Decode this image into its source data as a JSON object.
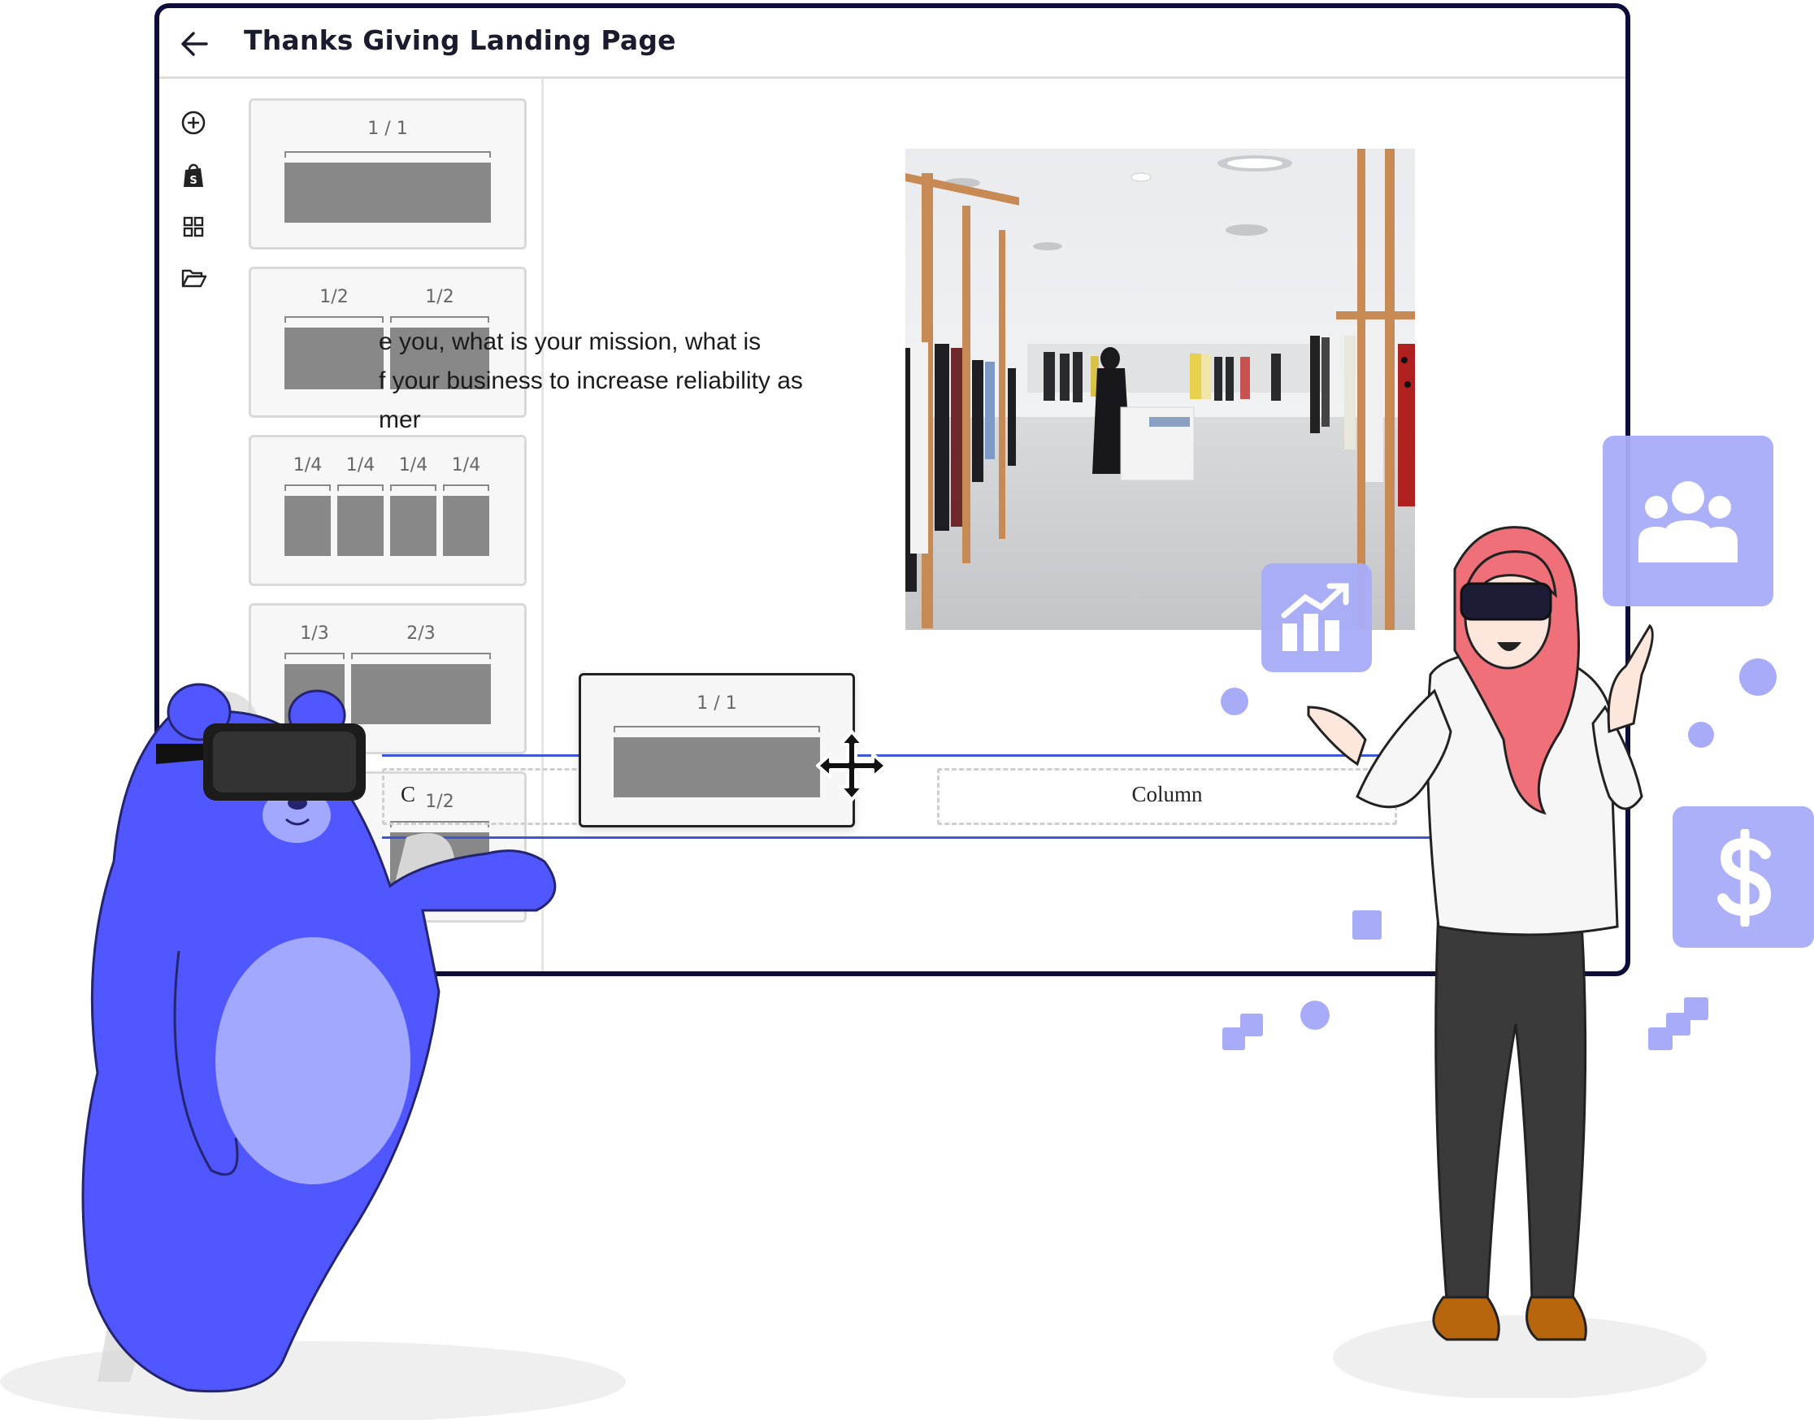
{
  "editor": {
    "title": "Thanks Giving Landing Page",
    "sidebar_icons": [
      "add-circle-icon",
      "shopify-bag-icon",
      "grid-icon",
      "folder-open-icon"
    ],
    "layouts": [
      {
        "labels": [
          "1 / 1"
        ]
      },
      {
        "labels": [
          "1/2",
          "1/2"
        ]
      },
      {
        "labels": [
          "1/4",
          "1/4",
          "1/4",
          "1/4"
        ]
      },
      {
        "labels": [
          "1/3",
          "2/3"
        ]
      },
      {
        "labels": [
          "1/2"
        ]
      }
    ],
    "body_text": "e you, what is your mission, what is\nf your business to increase reliability as\nmer",
    "row": {
      "col1_fragment": "C",
      "col2_label": "Column"
    },
    "drag_card_label": "1 / 1"
  },
  "colors": {
    "window_border": "#0d0c3a",
    "row_highlight": "#3e57d6",
    "accent_tile": "#a8acf8",
    "bear_body": "#5057ff",
    "bear_belly": "#a3a8ff"
  },
  "decor_icons": [
    "chart-growth-icon",
    "users-group-icon",
    "dollar-icon"
  ]
}
